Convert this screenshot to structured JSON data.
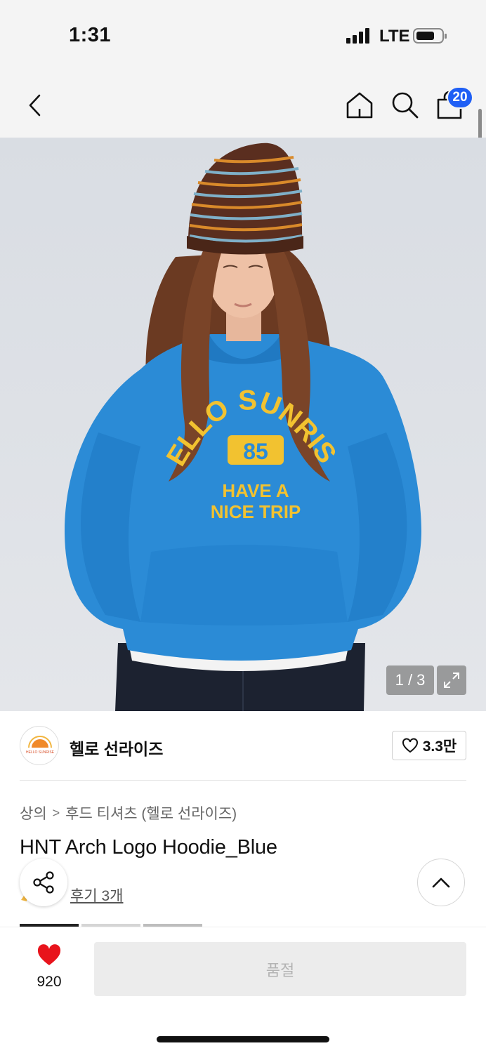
{
  "status_bar": {
    "time": "1:31",
    "network": "LTE"
  },
  "nav": {
    "back_icon": "chevron-left-icon",
    "home_icon": "home-icon",
    "search_icon": "search-icon",
    "bag_icon": "shopping-bag-icon",
    "cart_count": "20"
  },
  "gallery": {
    "counter": "1 / 3",
    "shirt_lines": [
      "HELLO SUNRISE",
      "85",
      "HAVE A",
      "NICE TRIP"
    ]
  },
  "brand": {
    "logo_text": "HELLO SUNRISE",
    "name": "헬로 선라이즈",
    "likes": "3.3만"
  },
  "breadcrumb": {
    "category": "상의",
    "subcategory": "후드 티셔츠 (헬로 선라이즈)"
  },
  "product": {
    "title": "HNT Arch Logo Hoodie_Blue",
    "review_link": "후기 3개"
  },
  "bottom_bar": {
    "wish_count": "920",
    "buy_button": "품절"
  },
  "colors": {
    "accent_blue": "#1f5ff5",
    "heart_red": "#e8141c",
    "hoodie_blue": "#2b8bd6",
    "print_yellow": "#f2c230"
  }
}
